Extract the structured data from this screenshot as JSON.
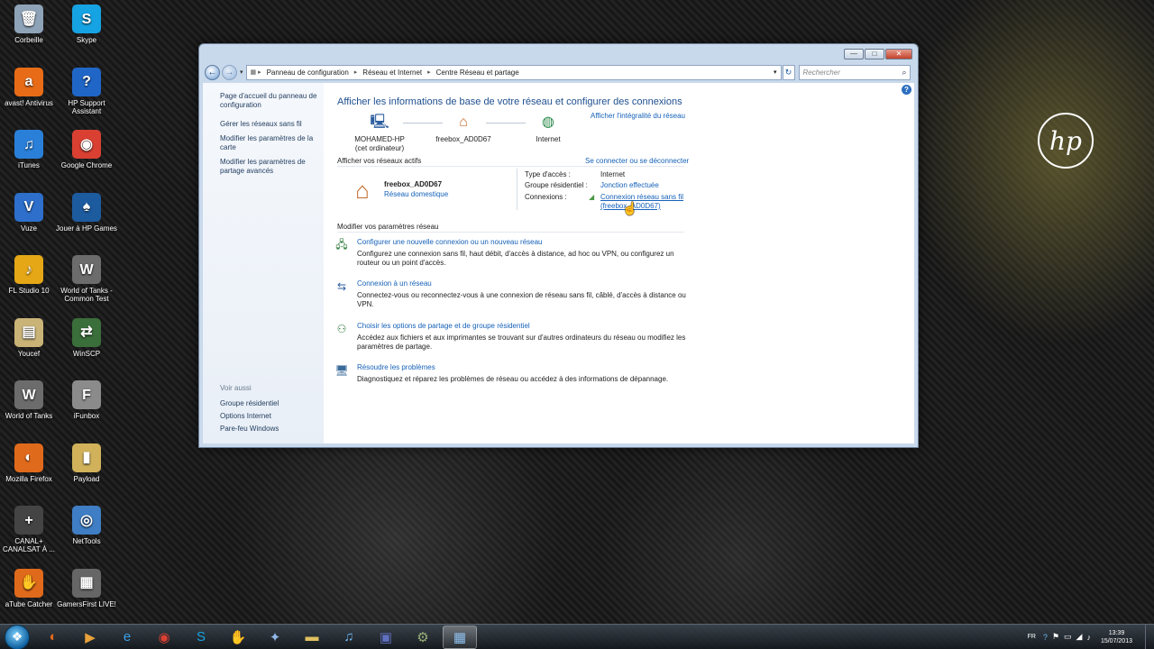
{
  "desktop": {
    "icons": [
      {
        "label": "Corbeille",
        "glyph": "🗑",
        "color": "#8fa3b8"
      },
      {
        "label": "Skype",
        "glyph": "S",
        "color": "#16a3e3"
      },
      {
        "label": "avast! Antivirus",
        "glyph": "a",
        "color": "#e86c17"
      },
      {
        "label": "HP Support Assistant",
        "glyph": "?",
        "color": "#1f66c7"
      },
      {
        "label": "iTunes",
        "glyph": "♫",
        "color": "#2a7fd8"
      },
      {
        "label": "Google Chrome",
        "glyph": "◉",
        "color": "#d94032"
      },
      {
        "label": "Vuze",
        "glyph": "V",
        "color": "#2d6fcb"
      },
      {
        "label": "Jouer à HP Games",
        "glyph": "♠",
        "color": "#1d5b9f"
      },
      {
        "label": "FL Studio 10",
        "glyph": "♪",
        "color": "#e5a716"
      },
      {
        "label": "World of Tanks - Common Test",
        "glyph": "W",
        "color": "#6c6c6c"
      },
      {
        "label": "Youcef",
        "glyph": "▤",
        "color": "#c9b377"
      },
      {
        "label": "WinSCP",
        "glyph": "⇄",
        "color": "#3a6e3a"
      },
      {
        "label": "World of Tanks",
        "glyph": "W",
        "color": "#6c6c6c"
      },
      {
        "label": "iFunbox",
        "glyph": "F",
        "color": "#8b8b8b"
      },
      {
        "label": "Mozilla Firefox",
        "glyph": "◐",
        "color": "#e06a1c"
      },
      {
        "label": "Payload",
        "glyph": "▮",
        "color": "#d1b25a"
      },
      {
        "label": "CANAL+ CANALSAT À ...",
        "glyph": "+",
        "color": "#444444"
      },
      {
        "label": "NetTools",
        "glyph": "◎",
        "color": "#3f7ec4"
      },
      {
        "label": "aTube Catcher",
        "glyph": "✋",
        "color": "#e06a1c"
      },
      {
        "label": "GamersFirst LIVE!",
        "glyph": "▦",
        "color": "#666666"
      }
    ],
    "brand": "hp"
  },
  "window": {
    "controls": {
      "minimize": "—",
      "maximize": "□",
      "close": "✕"
    },
    "nav": {
      "back": "←",
      "forward": "→",
      "dropdown": "▾"
    },
    "breadcrumb": [
      "Panneau de configuration",
      "Réseau et Internet",
      "Centre Réseau et partage"
    ],
    "search_placeholder": "Rechercher",
    "refresh_glyph": "↻",
    "search_glyph": "⌕"
  },
  "sidebar": {
    "links": [
      "Page d'accueil du panneau de configuration",
      "Gérer les réseaux sans fil",
      "Modifier les paramètres de la carte",
      "Modifier les paramètres de partage avancés"
    ],
    "see_also_heading": "Voir aussi",
    "see_also": [
      "Groupe résidentiel",
      "Options Internet",
      "Pare-feu Windows"
    ]
  },
  "main": {
    "title": "Afficher les informations de base de votre réseau et configurer des connexions",
    "full_map_link": "Afficher l'intégralité du réseau",
    "map": {
      "computer": {
        "name": "MOHAMED-HP",
        "sub": "(cet ordinateur)"
      },
      "router": {
        "name": "freebox_AD0D67"
      },
      "internet": {
        "name": "Internet"
      }
    },
    "active_heading": "Afficher vos réseaux actifs",
    "connect_link": "Se connecter ou se déconnecter",
    "network": {
      "name": "freebox_AD0D67",
      "type": "Réseau domestique",
      "access_label": "Type d'accès :",
      "access_value": "Internet",
      "homegroup_label": "Groupe résidentiel :",
      "homegroup_value": "Jonction effectuée",
      "connections_label": "Connexions :",
      "connections_value": "Connexion réseau sans fil (freebox_AD0D67)"
    },
    "settings_heading": "Modifier vos paramètres réseau",
    "tasks": [
      {
        "title": "Configurer une nouvelle connexion ou un nouveau réseau",
        "desc": "Configurez une connexion sans fil, haut débit, d'accès à distance, ad hoc ou VPN, ou configurez un routeur ou un point d'accès.",
        "icon": "🖧"
      },
      {
        "title": "Connexion à un réseau",
        "desc": "Connectez-vous ou reconnectez-vous à une connexion de réseau sans fil, câblé, d'accès à distance ou VPN.",
        "icon": "⇆"
      },
      {
        "title": "Choisir les options de partage et de groupe résidentiel",
        "desc": "Accédez aux fichiers et aux imprimantes se trouvant sur d'autres ordinateurs du réseau ou modifiez les paramètres de partage.",
        "icon": "⚇"
      },
      {
        "title": "Résoudre les problèmes",
        "desc": "Diagnostiquez et réparez les problèmes de réseau ou accédez à des informations de dépannage.",
        "icon": "🖥"
      }
    ]
  },
  "taskbar": {
    "items": [
      {
        "glyph": "◐",
        "color": "#e06a1c"
      },
      {
        "glyph": "▶",
        "color": "#e8a23a"
      },
      {
        "glyph": "e",
        "color": "#3aa0e8"
      },
      {
        "glyph": "◉",
        "color": "#d94032"
      },
      {
        "glyph": "S",
        "color": "#16a3e3"
      },
      {
        "glyph": "✋",
        "color": "#e06a1c"
      },
      {
        "glyph": "✦",
        "color": "#8fb7e8"
      },
      {
        "glyph": "▬",
        "color": "#e0c060"
      },
      {
        "glyph": "♫",
        "color": "#6fb6f0"
      },
      {
        "glyph": "▣",
        "color": "#6070c0"
      },
      {
        "glyph": "⚙",
        "color": "#9ab07a"
      },
      {
        "glyph": "▦",
        "color": "#8fc0ee"
      }
    ],
    "lang": "FR",
    "time": "13:39",
    "date": "15/07/2013"
  }
}
